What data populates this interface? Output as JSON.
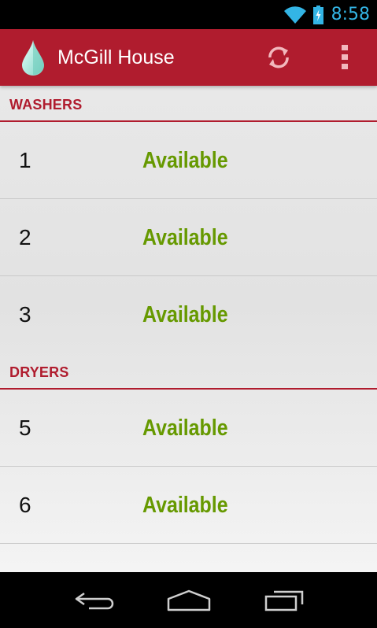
{
  "status_bar": {
    "time": "8:58"
  },
  "action_bar": {
    "title": "McGill House"
  },
  "sections": [
    {
      "title": "WASHERS",
      "machines": [
        {
          "number": "1",
          "status": "Available"
        },
        {
          "number": "2",
          "status": "Available"
        },
        {
          "number": "3",
          "status": "Available"
        }
      ]
    },
    {
      "title": "DRYERS",
      "machines": [
        {
          "number": "5",
          "status": "Available"
        },
        {
          "number": "6",
          "status": "Available"
        },
        {
          "number": "",
          "status": ""
        }
      ]
    }
  ],
  "colors": {
    "accent": "#b01c2e",
    "available": "#669900",
    "clock": "#33b5e5"
  },
  "icons": [
    "wifi-icon",
    "battery-charging-icon",
    "app-drop-icon",
    "refresh-icon",
    "overflow-menu-icon",
    "back-icon",
    "home-icon",
    "recent-apps-icon"
  ]
}
